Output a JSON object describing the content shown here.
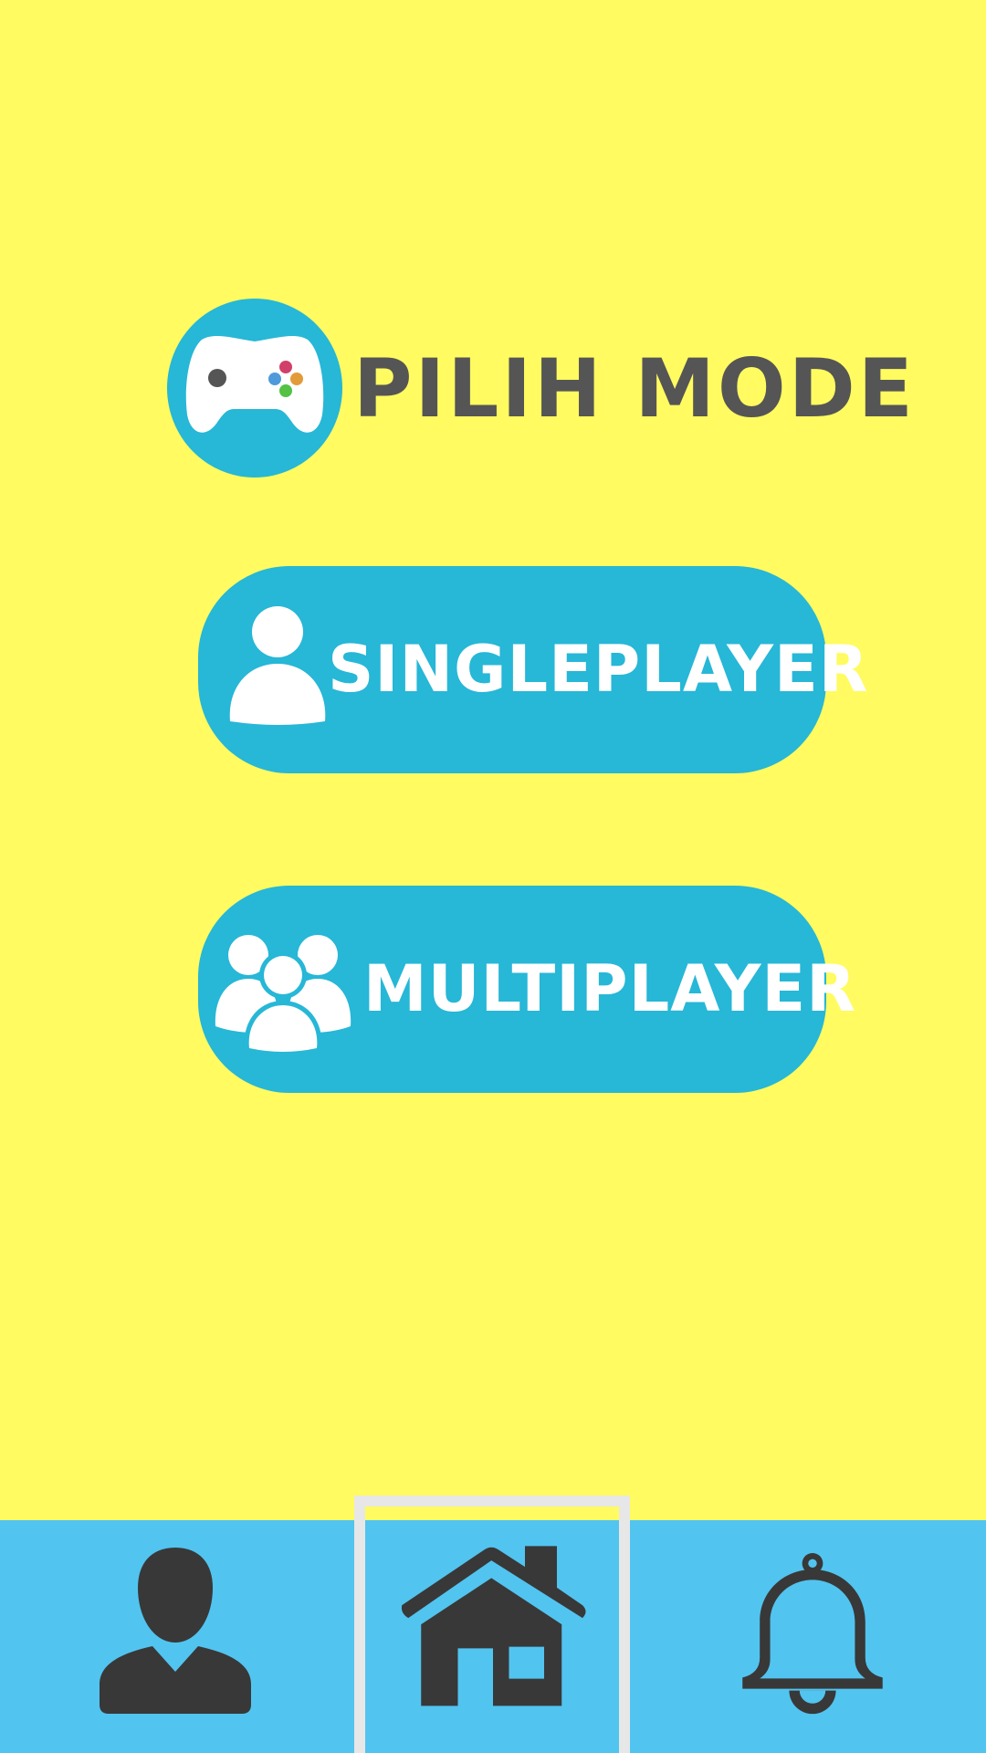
{
  "screen": {
    "background_color": "#FFFB60",
    "accent_color": "#27B7D7",
    "nav_color": "#52C4F0",
    "text_color": "#555555",
    "icon_color": "#383838"
  },
  "header": {
    "icon": "gamepad-icon",
    "title": "PILIH MODE"
  },
  "modes": {
    "singleplayer": {
      "label": "SINGLEPLAYER",
      "icon": "single-user-icon"
    },
    "multiplayer": {
      "label": "MULTIPLAYER",
      "icon": "user-group-icon"
    }
  },
  "bottom_nav": {
    "items": [
      {
        "id": "profile",
        "icon": "user-icon",
        "selected": false
      },
      {
        "id": "home",
        "icon": "home-icon",
        "selected": true
      },
      {
        "id": "notifications",
        "icon": "bell-icon",
        "selected": false
      }
    ]
  }
}
